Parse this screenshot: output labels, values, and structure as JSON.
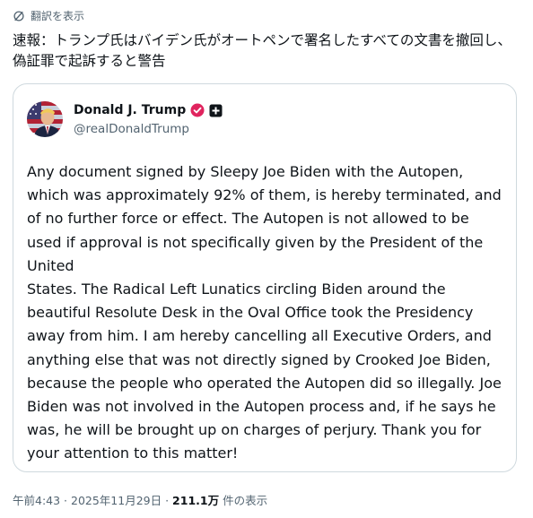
{
  "translate": {
    "icon": "translate-icon",
    "label": "翻訳を表示"
  },
  "post": {
    "text": "速報：トランプ氏はバイデン氏がオートペンで署名したすべての文書を撤回し、偽証罪で起訴すると警告"
  },
  "quote": {
    "avatar": "avatar",
    "author_name": "Donald J. Trump",
    "verified_icon": "verified-badge-icon",
    "affiliate_icon": "affiliate-badge-icon",
    "handle": "@realDonaldTrump",
    "body": "Any document signed by Sleepy Joe Biden with the Autopen, which was approximately 92% of them, is hereby terminated, and of no further force or effect. The Autopen is not allowed to be used if approval is not specifically given by the President of the United\nStates. The Radical Left Lunatics circling Biden around the beautiful Resolute Desk in the Oval Office took the Presidency away from him. I am hereby cancelling all Executive Orders, and anything else that was not directly signed by Crooked Joe Biden, because the people who operated the Autopen did so illegally. Joe Biden was not involved in the Autopen process and, if he says he was, he will be brought up on charges of perjury. Thank you for your attention to this matter!"
  },
  "meta": {
    "time": "午前4:43",
    "separator": " · ",
    "date": "2025年11月29日",
    "separator2": " · ",
    "views": "211.1万",
    "views_suffix": " 件の表示"
  },
  "colors": {
    "text": "#0f1419",
    "muted": "#536471",
    "border": "#cfd9de",
    "verified": "#e0245e"
  }
}
